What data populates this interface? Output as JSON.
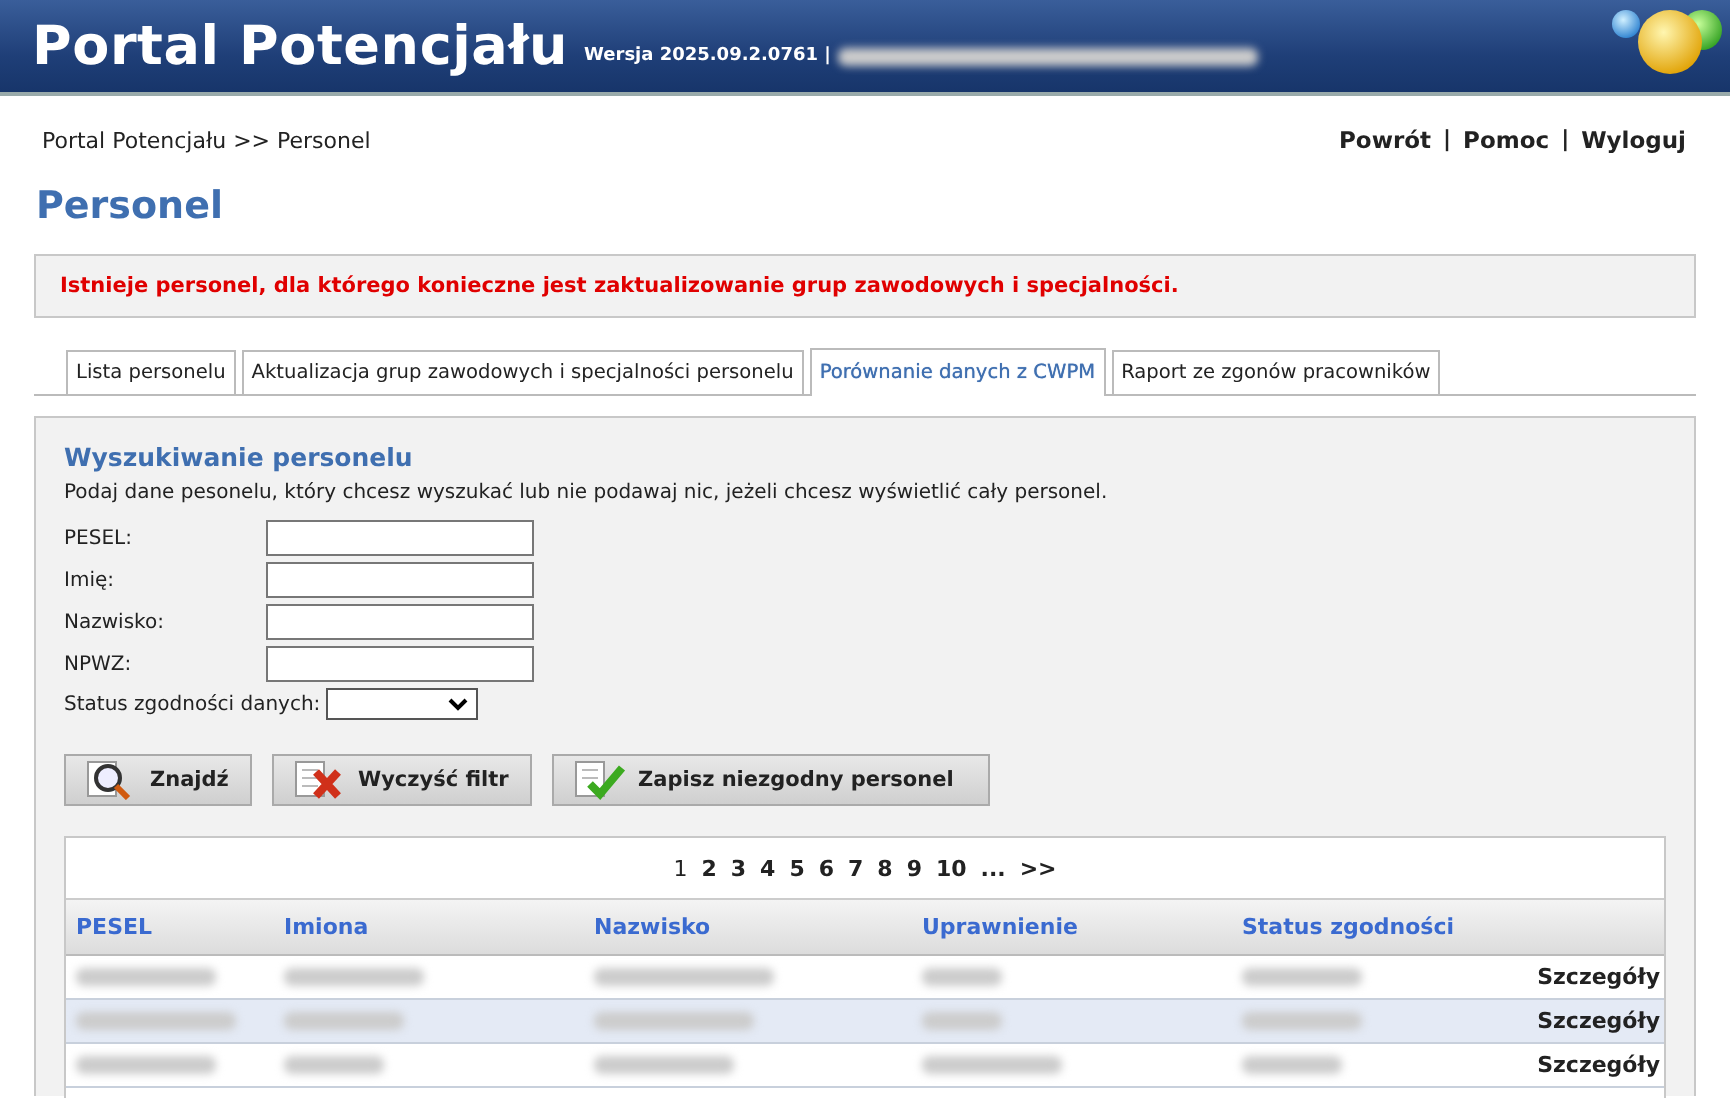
{
  "header": {
    "title": "Portal Potencjału",
    "version": "Wersja 2025.09.2.0761 |"
  },
  "breadcrumb": "Portal Potencjału >> Personel",
  "top_links": [
    {
      "label": "Powrót",
      "separator": "|"
    },
    {
      "label": "Pomoc",
      "separator": "|"
    },
    {
      "label": "Wyloguj"
    }
  ],
  "page_title": "Personel",
  "alert": "Istnieje personel, dla którego konieczne jest zaktualizowanie grup zawodowych i specjalności.",
  "tabs": [
    {
      "label": "Lista personelu",
      "selected": false
    },
    {
      "label": "Aktualizacja grup zawodowych i specjalności personelu",
      "selected": false
    },
    {
      "label": "Porównanie danych z CWPM",
      "selected": true
    },
    {
      "label": "Raport ze zgonów pracowników",
      "selected": false
    }
  ],
  "search": {
    "title": "Wyszukiwanie personelu",
    "hint": "Podaj dane pesonelu, który chcesz wyszukać lub nie podawaj nic, jeżeli chcesz wyświetlić cały personel.",
    "fields": [
      {
        "label": "PESEL:"
      },
      {
        "label": "Imię:"
      },
      {
        "label": "Nazwisko:"
      },
      {
        "label": "NPWZ:"
      }
    ],
    "select_label": "Status zgodności danych:",
    "buttons": [
      {
        "label": "Znajdź",
        "kind": "find"
      },
      {
        "label": "Wyczyść filtr",
        "kind": "clear"
      },
      {
        "label": "Zapisz niezgodny personel",
        "kind": "save"
      }
    ]
  },
  "table": {
    "pages": [
      {
        "label": "1",
        "selected": true
      },
      {
        "label": "2",
        "selected": false
      },
      {
        "label": "3",
        "selected": false
      },
      {
        "label": "4",
        "selected": false
      },
      {
        "label": "5",
        "selected": false
      },
      {
        "label": "6",
        "selected": false
      },
      {
        "label": "7",
        "selected": false
      },
      {
        "label": "8",
        "selected": false
      },
      {
        "label": "9",
        "selected": false
      },
      {
        "label": "10",
        "selected": false
      },
      {
        "label": "...",
        "selected": false
      },
      {
        "label": ">>",
        "selected": false
      }
    ],
    "columns": [
      "PESEL",
      "Imiona",
      "Nazwisko",
      "Uprawnienie",
      "Status zgodności"
    ],
    "rows": [
      {
        "link": "Szczegóły",
        "highlighted": false
      },
      {
        "link": "Szczegóły",
        "highlighted": true
      },
      {
        "link": "Szczegóły",
        "highlighted": false
      }
    ]
  }
}
